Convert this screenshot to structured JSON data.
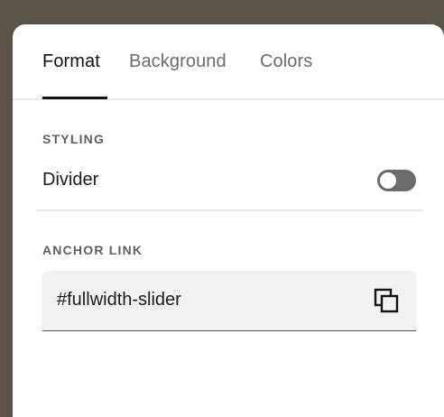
{
  "tabs": [
    {
      "label": "Format",
      "active": true
    },
    {
      "label": "Background",
      "active": false
    },
    {
      "label": "Colors",
      "active": false
    }
  ],
  "styling": {
    "section_label": "STYLING",
    "divider_label": "Divider",
    "divider_enabled": false
  },
  "anchor": {
    "section_label": "ANCHOR LINK",
    "value": "#fullwidth-slider",
    "copy_icon": "copy-icon"
  },
  "colors": {
    "accent": "#111111",
    "toggle_off": "#6b6b6b",
    "input_bg": "#f2f2f2"
  }
}
